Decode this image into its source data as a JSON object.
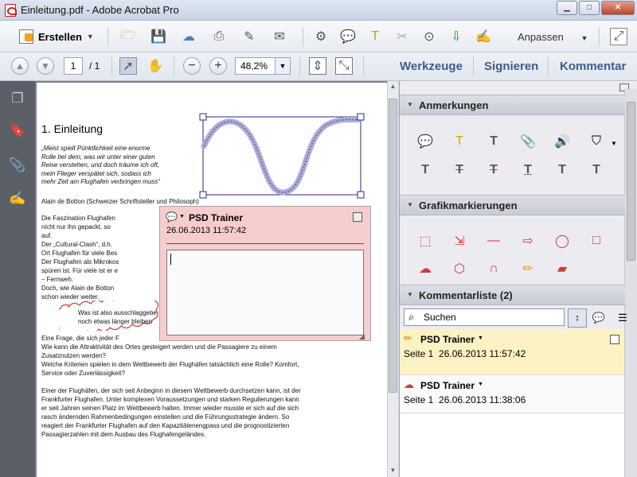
{
  "window": {
    "title": "Einleitung.pdf - Adobe Acrobat Pro"
  },
  "toolbar": {
    "create_label": "Erstellen",
    "customize_label": "Anpassen",
    "page_current": "1",
    "page_total": "/ 1",
    "zoom_value": "48,2%"
  },
  "tabs": {
    "tools": "Werkzeuge",
    "sign": "Signieren",
    "comment": "Kommentar"
  },
  "document": {
    "heading": "1. Einleitung",
    "quote": "„Meist spielt Pünktlichkeit eine enorme\nRolle bei dem, was wir unter einer guten\nReise verstehen, und doch träume ich oft,\nmein Flieger verspätet sich, sodass ich\nmehr Zeit am Flughafen verbringen muss“",
    "author_line": "Alain de Botton (Schweizer Schriftsteller und Philosoph)",
    "para1": [
      "Die Faszination Flughafen",
      "nicht nur ihn gepackt, so",
      "auf.",
      "Der „Cultural-Clash“, d.h.",
      "Ort Flughafen für viele Bes",
      "Der Flughafen als Mikrokos",
      "spüren ist. Für viele ist er e",
      "– Fernweh.",
      "Doch, wie Alain de Botton",
      "schon wieder weiter."
    ],
    "cloud_lines": [
      "Was ist also ausschlaggebe",
      "noch etwas länger bleiben"
    ],
    "para2": [
      "Eine Frage, die sich jeder F",
      "Wie kann die Attraktivität des Ortes gesteigert werden und die Passagiere zu einem",
      "Zusatznutzen werden?",
      "Welche Kriterien spielen in dem Wettbewerb der Flughäfen tatsächlich eine Rolle? Komfort,",
      "Service oder Zuverlässigkeit?"
    ],
    "para3": [
      "Einer der Flughäfen, der sich seit Anbeginn in diesem Wettbewerb durchsetzen kann, ist der",
      "Frankfurter Flughafen. Unter komplexen Voraussetzungen und starken Regulierungen kann",
      "er seit Jahren seinen Platz im Wettbewerb halten. Immer wieder musste er sich auf die sich",
      "rasch ändernden Rahmenbedingungen einstellen und die Führungsstrategie ändern. So",
      "reagiert der Frankfurter Flughafen auf den Kapazitätenengpass und die prognostizierten",
      "Passagierzahlen mit dem Ausbau des Flughafengeländes."
    ]
  },
  "popup": {
    "author": "PSD Trainer",
    "date": "26.06.2013 11:57:42"
  },
  "panel": {
    "annotations_title": "Anmerkungen",
    "graphics_title": "Grafikmarkierungen",
    "comment_list_title": "Kommentarliste (2)",
    "search_placeholder": "Suchen",
    "comments": [
      {
        "author": "PSD Trainer",
        "page": "Seite 1",
        "date": "26.06.2013 11:57:42"
      },
      {
        "author": "PSD Trainer",
        "page": "Seite 1",
        "date": "26.06.2013 11:38:06"
      }
    ]
  },
  "colors": {
    "accent_tabs": "#3f5a8a",
    "popup_bg": "#f6cdcd",
    "selected_comment_bg": "#fdf2c4",
    "markup_red": "#d23a3a"
  }
}
